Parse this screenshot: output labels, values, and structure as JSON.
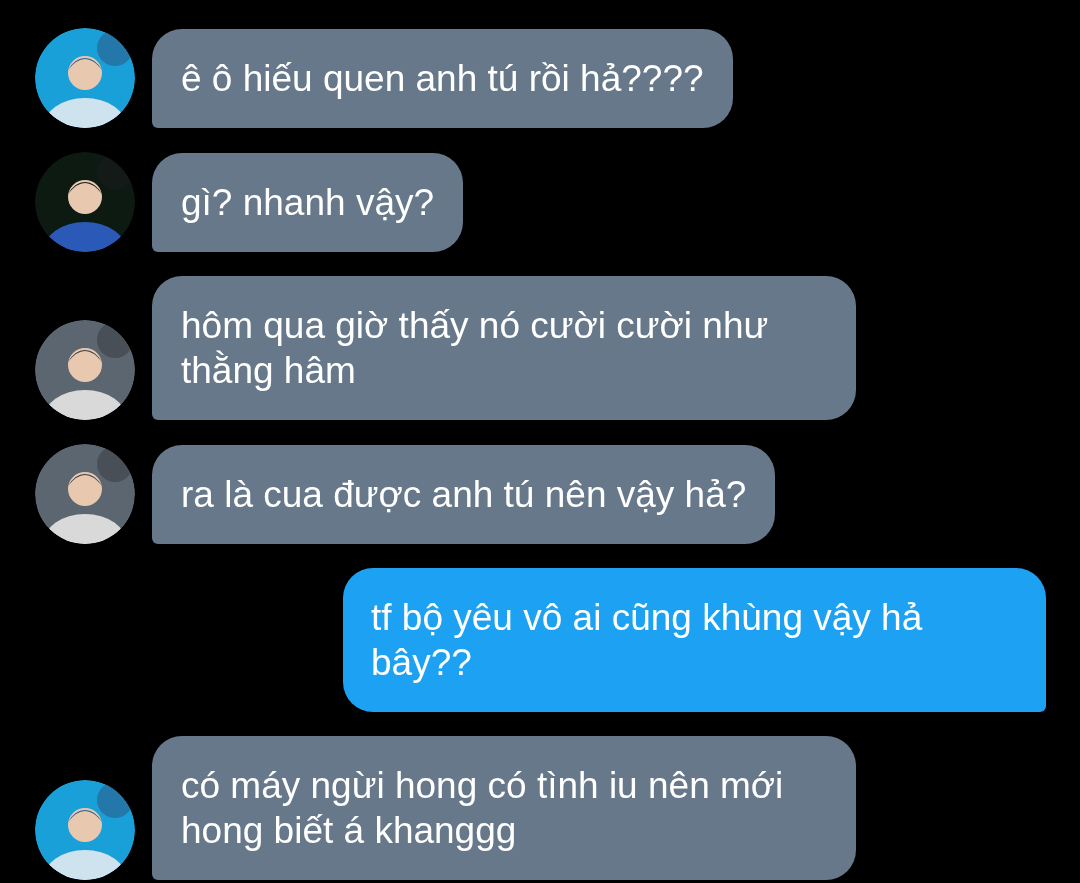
{
  "messages": [
    {
      "kind": "received",
      "text": "ê ô hiếu quen anh tú rồi hả????"
    },
    {
      "kind": "received",
      "text": "gì? nhanh vậy?"
    },
    {
      "kind": "received",
      "text": "hôm qua giờ thấy nó cười cười như thằng hâm"
    },
    {
      "kind": "received",
      "text": "ra là cua được anh tú nên vậy hả?"
    },
    {
      "kind": "sent",
      "text": "tf bộ yêu vô ai cũng khùng vậy hả bây??"
    },
    {
      "kind": "received",
      "text": "có máy ngừi hong có tình iu nên mới hong biết á khanggg"
    }
  ]
}
